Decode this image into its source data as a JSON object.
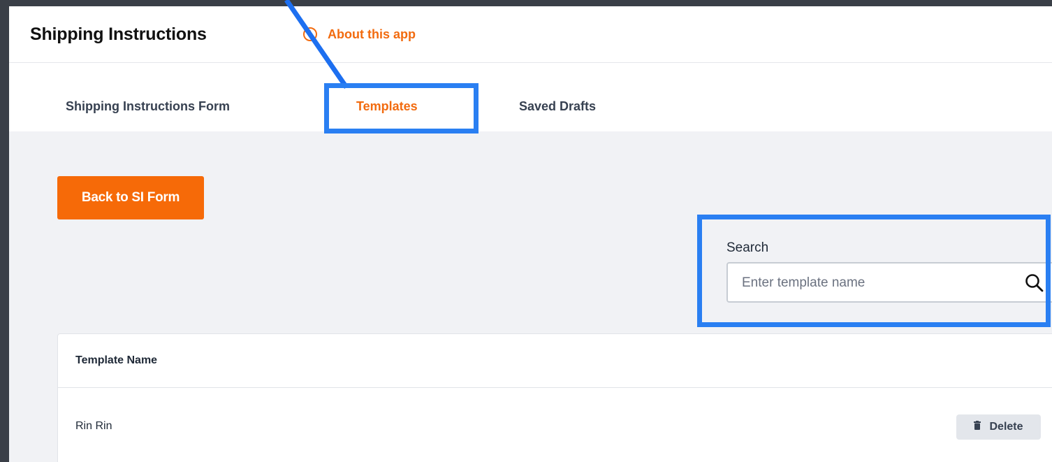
{
  "app": {
    "title": "Shipping Instructions",
    "about_link": "About this app",
    "accent_color": "#f26b0f",
    "highlight_color": "#2a7ff2"
  },
  "tabs": [
    {
      "label": "Shipping Instructions Form",
      "active": false
    },
    {
      "label": "Templates",
      "active": true
    },
    {
      "label": "Saved Drafts",
      "active": false
    }
  ],
  "toolbar": {
    "back_label": "Back to SI Form"
  },
  "search": {
    "label": "Search",
    "placeholder": "Enter template name",
    "value": "",
    "icon": "search-icon"
  },
  "table": {
    "headers": [
      "Template Name"
    ],
    "rows": [
      {
        "name": "Rin Rin",
        "action_label": "Delete",
        "action_icon": "trash-icon"
      }
    ]
  }
}
